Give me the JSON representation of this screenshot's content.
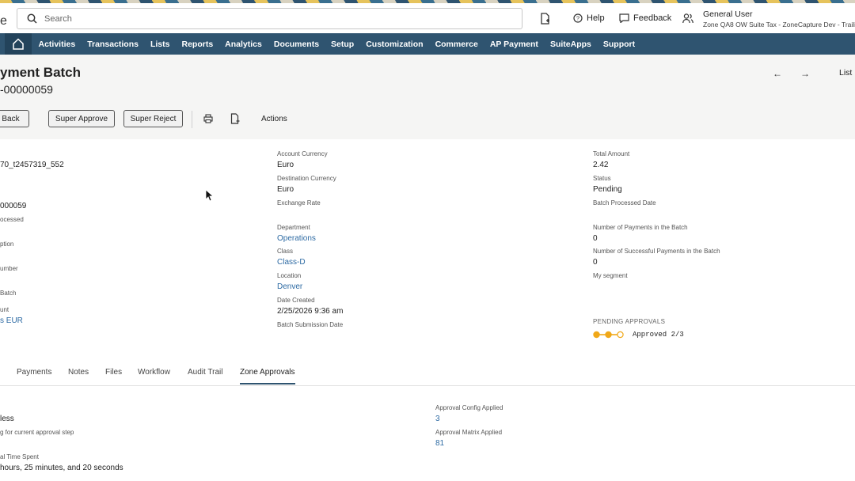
{
  "topbar": {
    "logo_fragment": "e",
    "search_placeholder": "Search",
    "help_label": "Help",
    "feedback_label": "Feedback",
    "user_name": "General User",
    "user_role": "Zone QA8 OW Suite Tax - ZoneCapture Dev - Trailing"
  },
  "nav": {
    "items": [
      "Activities",
      "Transactions",
      "Lists",
      "Reports",
      "Analytics",
      "Documents",
      "Setup",
      "Customization",
      "Commerce",
      "AP Payment",
      "SuiteApps",
      "Support"
    ]
  },
  "header": {
    "title": "yment Batch",
    "record_id": "-00000059",
    "prev_label": "←",
    "next_label": "→",
    "list_label": "List"
  },
  "toolbar": {
    "back_label": "Back",
    "super_approve_label": "Super Approve",
    "super_reject_label": "Super Reject",
    "actions_label": "Actions"
  },
  "fields": {
    "col1": {
      "name_value": "70_t2457319_552",
      "number_value": "000059",
      "processed_label": "ocessed",
      "description_label": "ption",
      "number_label": "umber",
      "batch_label": "Batch",
      "account_label": "unt",
      "account_value": "s EUR"
    },
    "col2": {
      "account_currency_label": "Account Currency",
      "account_currency_value": "Euro",
      "destination_currency_label": "Destination Currency",
      "destination_currency_value": "Euro",
      "exchange_rate_label": "Exchange Rate",
      "department_label": "Department",
      "department_value": "Operations",
      "class_label": "Class",
      "class_value": "Class-D",
      "location_label": "Location",
      "location_value": "Denver",
      "date_created_label": "Date Created",
      "date_created_value": "2/25/2026 9:36 am",
      "batch_submission_label": "Batch Submission Date"
    },
    "col3": {
      "total_amount_label": "Total Amount",
      "total_amount_value": "2.42",
      "status_label": "Status",
      "status_value": "Pending",
      "batch_processed_label": "Batch Processed Date",
      "num_payments_label": "Number of Payments in the Batch",
      "num_payments_value": "0",
      "num_success_label": "Number of Successful Payments in the Batch",
      "num_success_value": "0",
      "segment_label": "My segment",
      "pending_approvals_label": "PENDING APPROVALS",
      "approved_text": "Approved 2/3",
      "approved_count": 2,
      "approval_total": 3
    }
  },
  "tabs": {
    "items": [
      "Payments",
      "Notes",
      "Files",
      "Workflow",
      "Audit Trail",
      "Zone Approvals"
    ],
    "active": "Zone Approvals"
  },
  "zone": {
    "value1": "less",
    "label2": "g for current approval step",
    "label3": "al Time Spent",
    "value3": "hours, 25 minutes, and 20 seconds",
    "config_label": "Approval Config Applied",
    "config_value": "3",
    "matrix_label": "Approval Matrix Applied",
    "matrix_value": "81"
  },
  "colors": {
    "nav_bg": "#2f5470",
    "link": "#2d6aa3",
    "approval": "#f0a818"
  }
}
